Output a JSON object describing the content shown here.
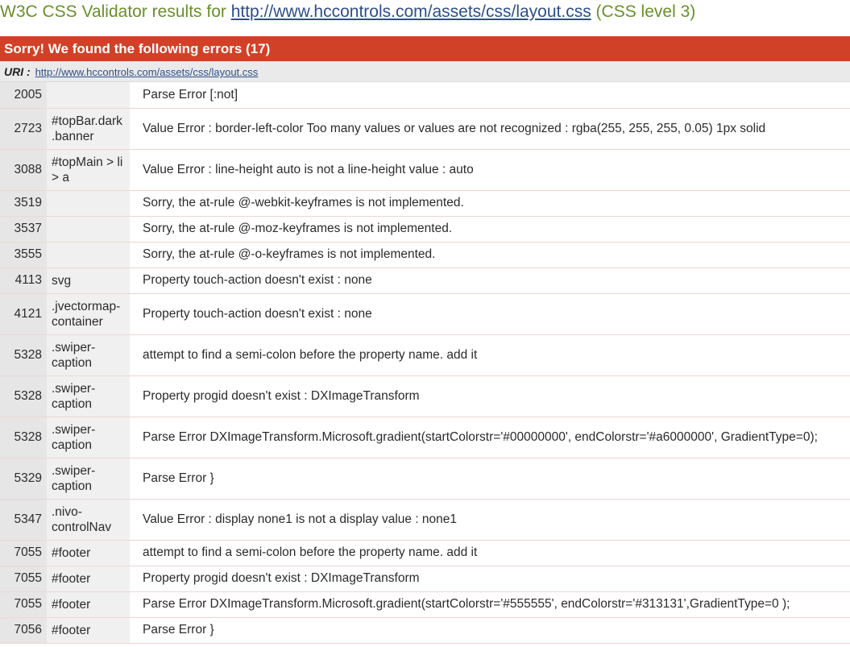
{
  "header": {
    "title_prefix": "W3C CSS Validator results for ",
    "title_url": "http://www.hccontrols.com/assets/css/layout.css",
    "title_suffix": " (CSS level 3)"
  },
  "errors_banner": {
    "text": "Sorry! We found the following errors (17)"
  },
  "uri": {
    "label": "URI :",
    "link": "http://www.hccontrols.com/assets/css/layout.css"
  },
  "colors": {
    "banner": "#d14127",
    "title_green": "#6a8f2a",
    "link_blue": "#2d4f8a"
  },
  "errors": [
    {
      "line": "2005",
      "context": "",
      "message": "Parse Error [:not]"
    },
    {
      "line": "2723",
      "context": "#topBar.dark .banner",
      "message": "Value Error : border-left-color Too many values or values are not recognized : rgba(255, 255, 255, 0.05) 1px solid"
    },
    {
      "line": "3088",
      "context": "#topMain > li > a",
      "message": "Value Error : line-height auto is not a line-height value : auto"
    },
    {
      "line": "3519",
      "context": "",
      "message": "Sorry, the at-rule @-webkit-keyframes is not implemented."
    },
    {
      "line": "3537",
      "context": "",
      "message": "Sorry, the at-rule @-moz-keyframes is not implemented."
    },
    {
      "line": "3555",
      "context": "",
      "message": "Sorry, the at-rule @-o-keyframes is not implemented."
    },
    {
      "line": "4113",
      "context": "svg",
      "message": "Property touch-action doesn't exist : none"
    },
    {
      "line": "4121",
      "context": ".jvectormap-container",
      "message": "Property touch-action doesn't exist : none"
    },
    {
      "line": "5328",
      "context": ".swiper-caption",
      "message": "attempt to find a semi-colon before the property name. add it"
    },
    {
      "line": "5328",
      "context": ".swiper-caption",
      "message": "Property progid doesn't exist : DXImageTransform"
    },
    {
      "line": "5328",
      "context": ".swiper-caption",
      "message": "Parse Error DXImageTransform.Microsoft.gradient(startColorstr='#00000000', endColorstr='#a6000000', GradientType=0);"
    },
    {
      "line": "5329",
      "context": ".swiper-caption",
      "message": "Parse Error }"
    },
    {
      "line": "5347",
      "context": ".nivo-controlNav",
      "message": "Value Error : display none1 is not a display value : none1"
    },
    {
      "line": "7055",
      "context": "#footer",
      "message": "attempt to find a semi-colon before the property name. add it"
    },
    {
      "line": "7055",
      "context": "#footer",
      "message": "Property progid doesn't exist : DXImageTransform"
    },
    {
      "line": "7055",
      "context": "#footer",
      "message": "Parse Error DXImageTransform.Microsoft.gradient(startColorstr='#555555', endColorstr='#313131',GradientType=0 );"
    },
    {
      "line": "7056",
      "context": "#footer",
      "message": "Parse Error }"
    }
  ]
}
